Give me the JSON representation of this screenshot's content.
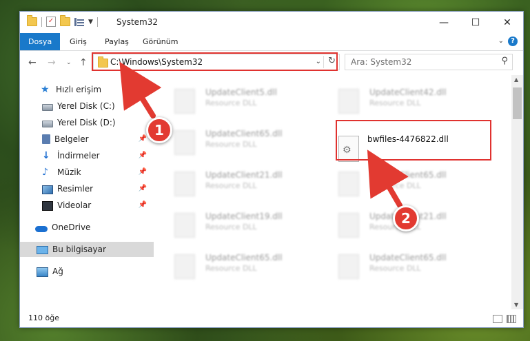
{
  "window": {
    "title": "System32"
  },
  "ribbon": {
    "tabs": [
      {
        "label": "Dosya",
        "active": true
      },
      {
        "label": "Giriş"
      },
      {
        "label": "Paylaş"
      },
      {
        "label": "Görünüm"
      }
    ]
  },
  "nav": {
    "address": "C:\\Windows\\System32",
    "search_placeholder": "Ara: System32"
  },
  "sidebar": {
    "items": [
      {
        "label": "Hızlı erişim"
      },
      {
        "label": "Yerel Disk (C:)"
      },
      {
        "label": "Yerel Disk (D:)"
      },
      {
        "label": "Belgeler"
      },
      {
        "label": "İndirmeler"
      },
      {
        "label": "Müzik"
      },
      {
        "label": "Resimler"
      },
      {
        "label": "Videolar"
      },
      {
        "label": "OneDrive"
      },
      {
        "label": "Bu bilgisayar"
      },
      {
        "label": "Ağ"
      }
    ]
  },
  "files": [
    {
      "name": "UpdateClient5.dll",
      "type": "Resource DLL"
    },
    {
      "name": "UpdateClient42.dll",
      "type": "Resource DLL"
    },
    {
      "name": "UpdateClient65.dll",
      "type": "Resource DLL"
    },
    {
      "name": "bwfiles-4476822.dll",
      "type": ""
    },
    {
      "name": "UpdateClient21.dll",
      "type": "Resource DLL"
    },
    {
      "name": "UpdateClient65.dll",
      "type": "Resource DLL"
    },
    {
      "name": "UpdateClient19.dll",
      "type": "Resource DLL"
    },
    {
      "name": "UpdateClient21.dll",
      "type": "Resource DLL"
    },
    {
      "name": "UpdateClient65.dll",
      "type": "Resource DLL"
    },
    {
      "name": "UpdateClient65.dll",
      "type": "Resource DLL"
    }
  ],
  "status": {
    "count": "110 öğe"
  },
  "annotations": {
    "step1": "1",
    "step2": "2"
  },
  "colors": {
    "accent": "#1979ca",
    "annotation_red": "#e0322f"
  }
}
